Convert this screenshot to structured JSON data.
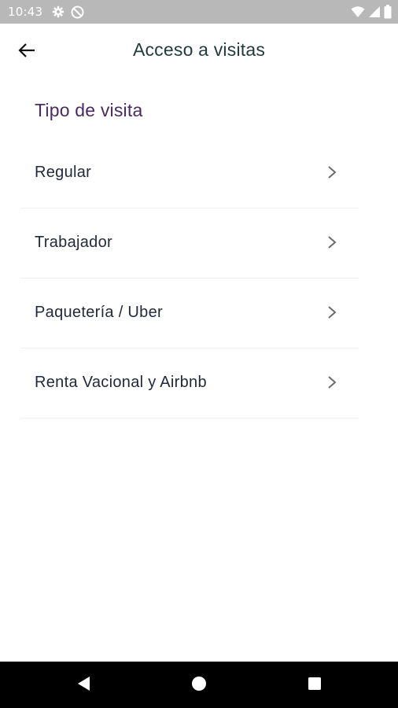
{
  "status_bar": {
    "time": "10:43",
    "icons": [
      "gear-icon",
      "do-not-disturb-icon",
      "wifi-icon",
      "signal-icon",
      "battery-icon"
    ]
  },
  "app_bar": {
    "back_icon": "arrow-left-icon",
    "title": "Acceso a visitas"
  },
  "section": {
    "title": "Tipo de visita"
  },
  "visit_types": [
    {
      "label": "Regular",
      "icon": "chevron-right-icon"
    },
    {
      "label": "Trabajador",
      "icon": "chevron-right-icon"
    },
    {
      "label": "Paquetería / Uber",
      "icon": "chevron-right-icon"
    },
    {
      "label": "Renta Vacional y Airbnb",
      "icon": "chevron-right-icon"
    }
  ],
  "nav_bar": {
    "buttons": [
      "back-triangle-icon",
      "home-circle-icon",
      "recents-square-icon"
    ]
  },
  "colors": {
    "status_bar_bg": "#b8b8b8",
    "title_text": "#1f3b3a",
    "section_title": "#4b2a63",
    "item_text": "#222a3a",
    "divider": "#f0f0f0",
    "chevron": "#6b6b6b",
    "nav_bar_bg": "#000000"
  }
}
